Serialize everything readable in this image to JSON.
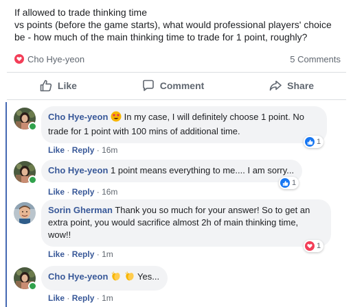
{
  "post": {
    "lines": [
      "If allowed to trade thinking time",
      "vs points (before the game starts), what would professional players' choice",
      "be - how much of the main thinking time to trade for 1 point, roughly?"
    ],
    "reactor": "Cho Hye-yeon",
    "comments_count": "5 Comments"
  },
  "actions": {
    "like": "Like",
    "comment": "Comment",
    "share": "Share"
  },
  "comments": [
    {
      "author": "Cho Hye-yeon",
      "text_line1": "In my case, I will definitely choose 1 point. No",
      "text_line2": "trade for 1 point with 100 mins of additional time.",
      "like": "Like",
      "reply": "Reply",
      "time": "16m",
      "reaction": "like",
      "reaction_count": "1"
    },
    {
      "author": "Cho Hye-yeon",
      "text": "1 point means everything to me.... I am sorry...",
      "like": "Like",
      "reply": "Reply",
      "time": "16m",
      "reaction": "like",
      "reaction_count": "1"
    },
    {
      "author": "Sorin Gherman",
      "text_line1": "Thank you so much for your answer! So to get an",
      "text_line2": "extra point, you would sacrifice almost 2h of main thinking time,",
      "text_line3": "wow!!",
      "like": "Like",
      "reply": "Reply",
      "time": "1m",
      "reaction": "love",
      "reaction_count": "1"
    },
    {
      "author": "Cho Hye-yeon",
      "text": "Yes...",
      "like": "Like",
      "reply": "Reply",
      "time": "1m"
    }
  ],
  "colors": {
    "link_blue": "#385898",
    "like_blue": "#1877f2",
    "love_red": "#f33e58",
    "thread_line": "#4267b2",
    "online_green": "#31a24c"
  },
  "icons": [
    "heart-icon",
    "thumbs-up-icon",
    "comment-icon",
    "share-icon",
    "star-struck-emoji-icon",
    "clapping-hands-emoji-icon"
  ]
}
